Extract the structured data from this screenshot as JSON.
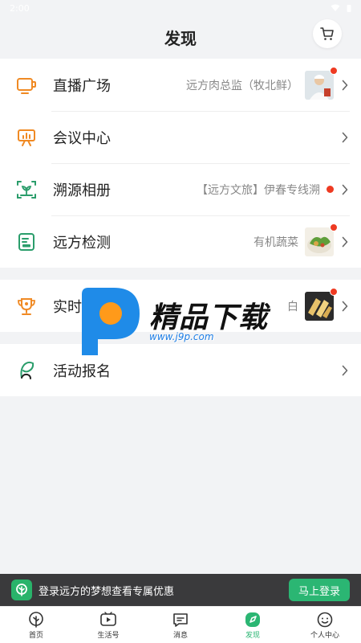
{
  "status_bar": {
    "time": "2:00"
  },
  "header": {
    "title": "发现"
  },
  "groups": [
    {
      "items": [
        {
          "title": "直播广场",
          "desc": "远方肉总监（牧北鲜）",
          "icon": "live-tv-icon",
          "has_thumb": true
        },
        {
          "title": "会议中心",
          "desc": "",
          "icon": "presentation-board-icon"
        },
        {
          "title": "溯源相册",
          "desc": "【远方文旅】伊春专线溯",
          "icon": "scan-plant-icon",
          "has_dot": true
        },
        {
          "title": "远方检测",
          "desc": "有机蔬菜",
          "icon": "inspection-report-icon",
          "has_thumb": true
        }
      ]
    },
    {
      "items": [
        {
          "title": "实时",
          "desc": "白",
          "icon": "trophy-icon",
          "has_thumb": true
        }
      ]
    },
    {
      "items": [
        {
          "title": "活动报名",
          "desc": "",
          "icon": "sprout-icon"
        }
      ]
    }
  ],
  "watermark": {
    "brand": "精品下载",
    "url": "www.j9p.com"
  },
  "login_banner": {
    "text": "登录远方的梦想查看专属优惠",
    "button": "马上登录"
  },
  "tabbar": [
    {
      "label": "首页",
      "icon": "tree-icon"
    },
    {
      "label": "生活号",
      "icon": "video-play-icon"
    },
    {
      "label": "消息",
      "icon": "message-icon"
    },
    {
      "label": "发现",
      "icon": "discover-compass-icon",
      "active": true
    },
    {
      "label": "个人中心",
      "icon": "smile-face-icon"
    }
  ],
  "colors": {
    "brand_green": "#2bb673",
    "icon_orange": "#f08a24",
    "icon_teal": "#2a9d6b",
    "alert_red": "#ee3a22"
  }
}
